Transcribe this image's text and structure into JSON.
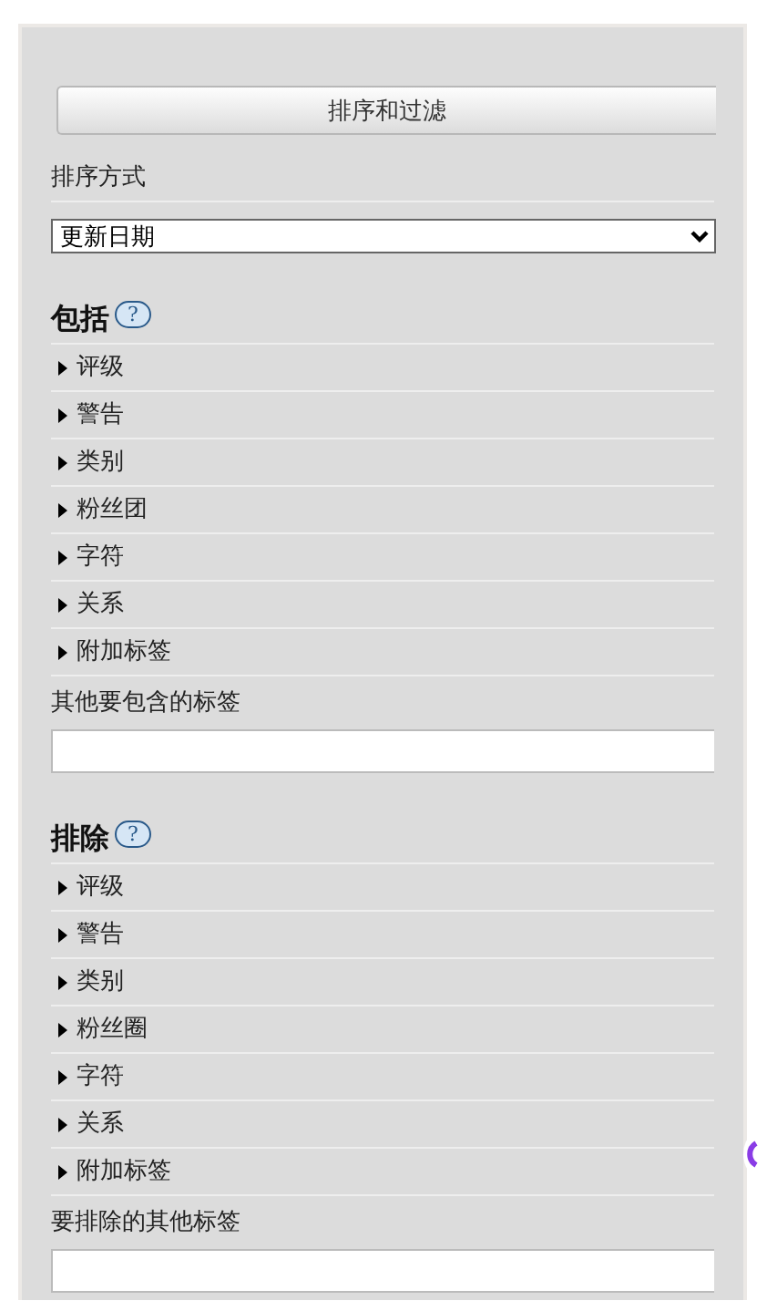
{
  "button": "排序和过滤",
  "sort": {
    "label": "排序方式",
    "value": "更新日期"
  },
  "sections": [
    {
      "heading": "包括",
      "help": "?",
      "items": [
        {
          "label": "评级",
          "expanded": false
        },
        {
          "label": "警告",
          "expanded": false
        },
        {
          "label": "类别",
          "expanded": false
        },
        {
          "label": "粉丝团",
          "expanded": false
        },
        {
          "label": "字符",
          "expanded": false
        },
        {
          "label": "关系",
          "expanded": false
        },
        {
          "label": "附加标签",
          "expanded": false
        }
      ],
      "tags_label": "其他要包含的标签"
    },
    {
      "heading": "排除",
      "help": "?",
      "items": [
        {
          "label": "评级",
          "expanded": false
        },
        {
          "label": "警告",
          "expanded": false
        },
        {
          "label": "类别",
          "expanded": false
        },
        {
          "label": "粉丝圈",
          "expanded": false
        },
        {
          "label": "字符",
          "expanded": false
        },
        {
          "label": "关系",
          "expanded": false
        },
        {
          "label": "附加标签",
          "expanded": false
        }
      ],
      "tags_label": "要排除的其他标签"
    }
  ]
}
